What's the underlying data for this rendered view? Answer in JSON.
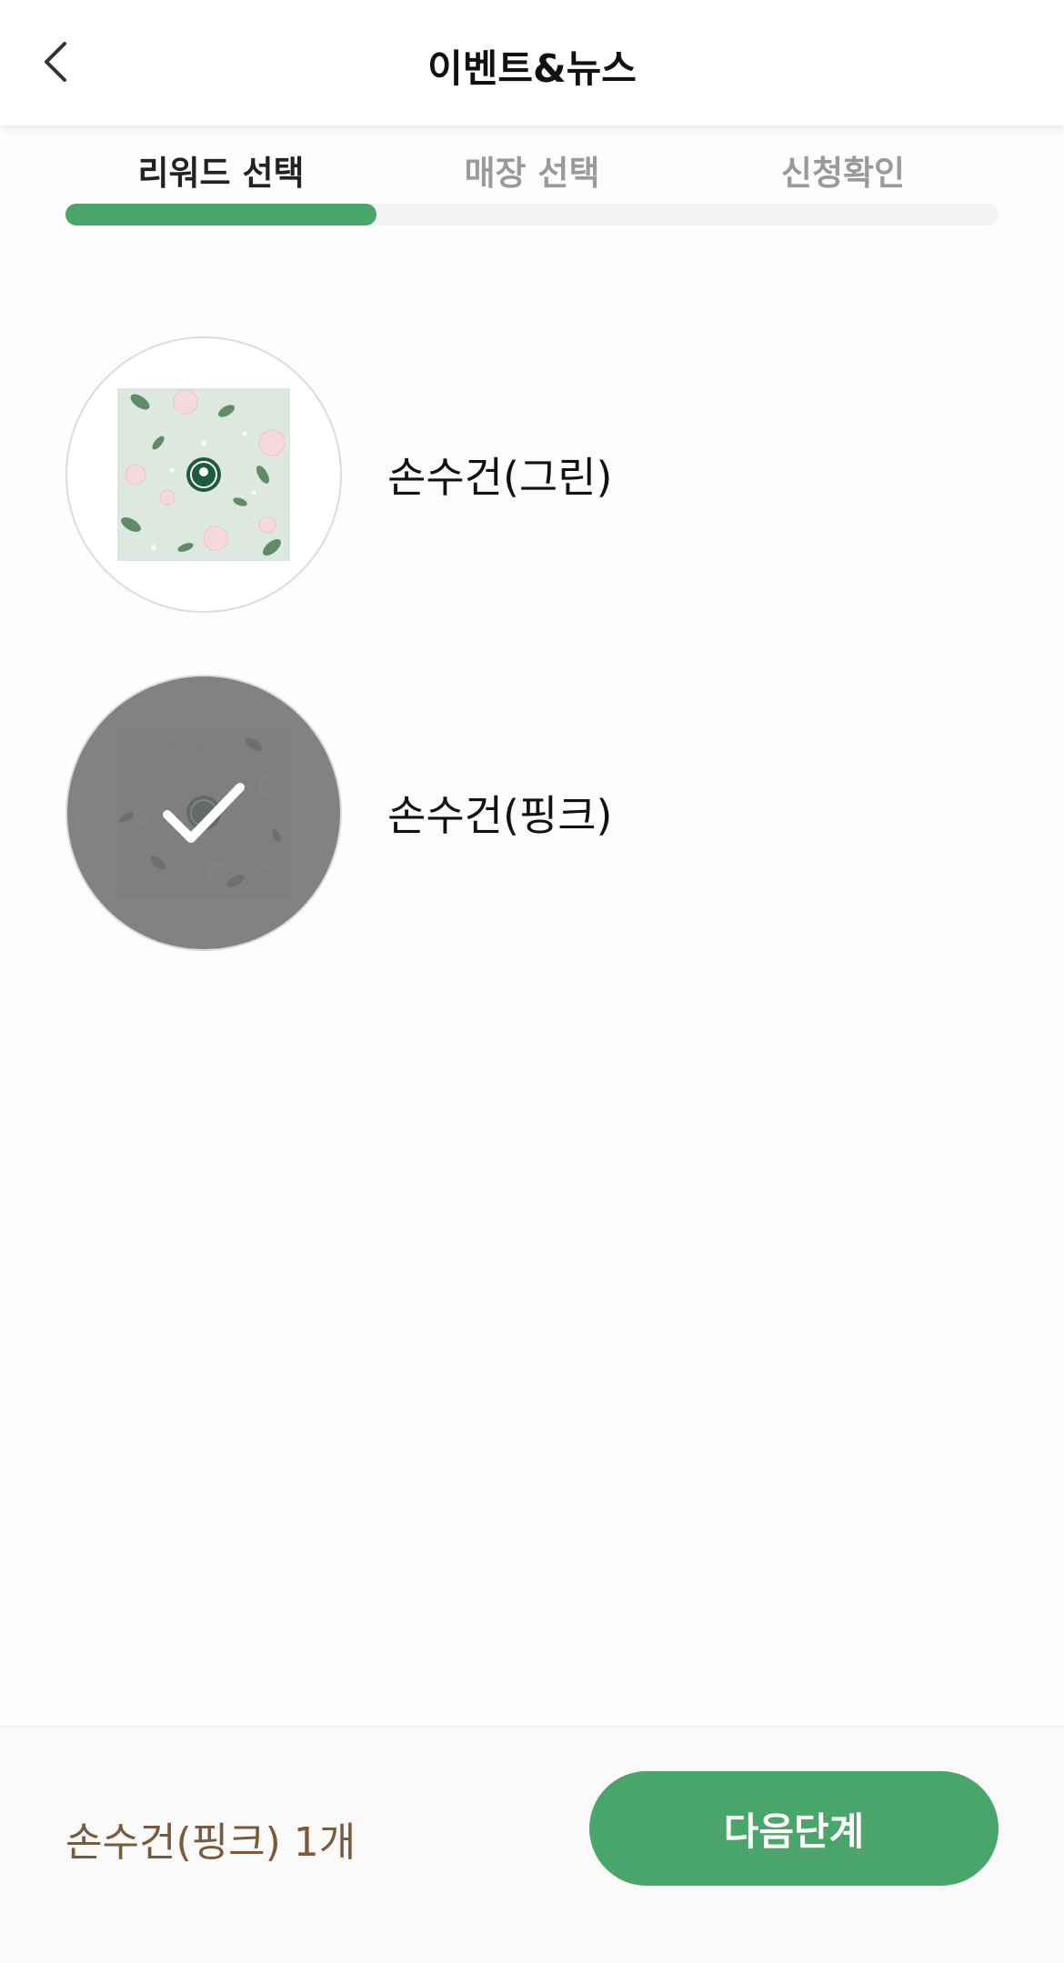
{
  "header": {
    "title": "이벤트&뉴스",
    "back_icon": "chevron-left-icon"
  },
  "steps": {
    "items": [
      {
        "label": "리워드 선택",
        "active": true
      },
      {
        "label": "매장 선택",
        "active": false
      },
      {
        "label": "신청확인",
        "active": false
      }
    ],
    "progress": 0.3333
  },
  "rewards": [
    {
      "name": "손수건(그린)",
      "selected": false,
      "pattern": "green"
    },
    {
      "name": "손수건(핑크)",
      "selected": true,
      "pattern": "pink"
    }
  ],
  "footer": {
    "selected_summary": "손수건(핑크) 1개",
    "next_label": "다음단계"
  },
  "colors": {
    "accent": "#4aa56a",
    "summary_text": "#7a5a3c",
    "overlay": "#6e6e6e"
  }
}
